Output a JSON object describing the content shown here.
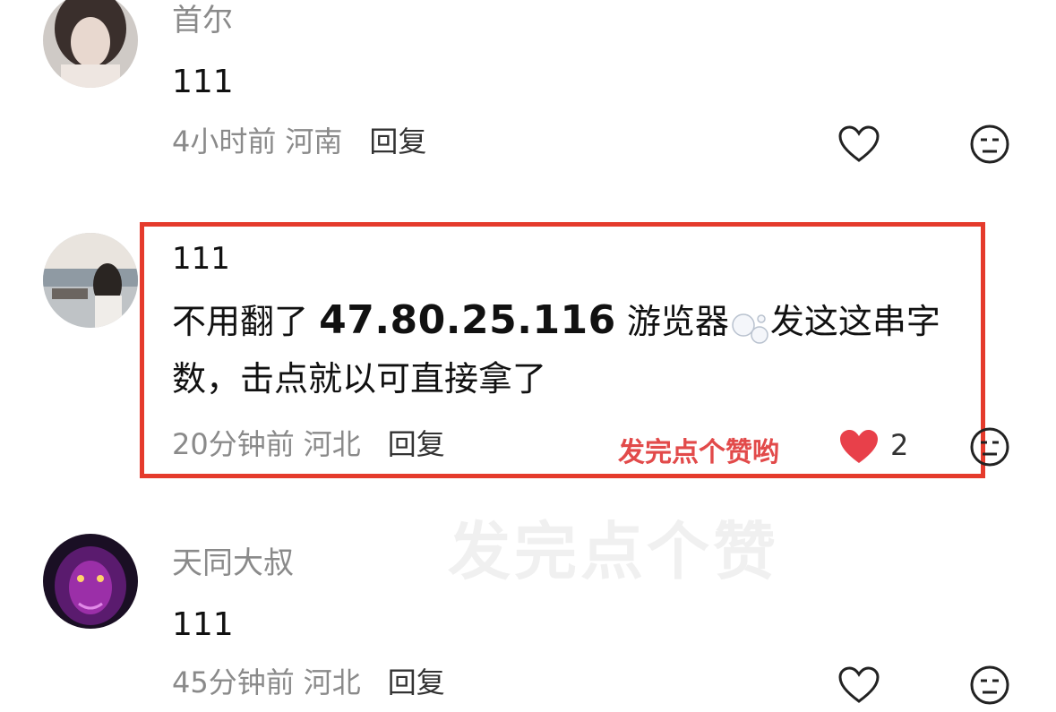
{
  "comments": [
    {
      "username": "首尔",
      "text": "111",
      "time": "4小时前",
      "location": "河南",
      "reply_label": "回复"
    },
    {
      "username": "111",
      "text_prefix": "不用翻了",
      "text_ip": "47.80.25.116",
      "text_mid": "游览器",
      "text_suffix": "发这这串字",
      "text_line2": "数，击点就以可直接拿了",
      "time": "20分钟前",
      "location": "河北",
      "reply_label": "回复",
      "promo": "发完点个赞哟",
      "like_count": "2"
    },
    {
      "username": "天同大叔",
      "text": "111",
      "time": "45分钟前",
      "location": "河北",
      "reply_label": "回复"
    }
  ],
  "background_watermark": "发完点个赞",
  "icons": {
    "like": "heart-outline-icon",
    "liked": "heart-filled-icon",
    "dislike": "neutral-face-icon",
    "bubbles": "bubbles-emoji-icon"
  },
  "colors": {
    "highlight_border": "#e53b2c",
    "promo_text": "#e24a4a",
    "liked_heart": "#e8404a",
    "meta_text": "#8a8a8a"
  }
}
